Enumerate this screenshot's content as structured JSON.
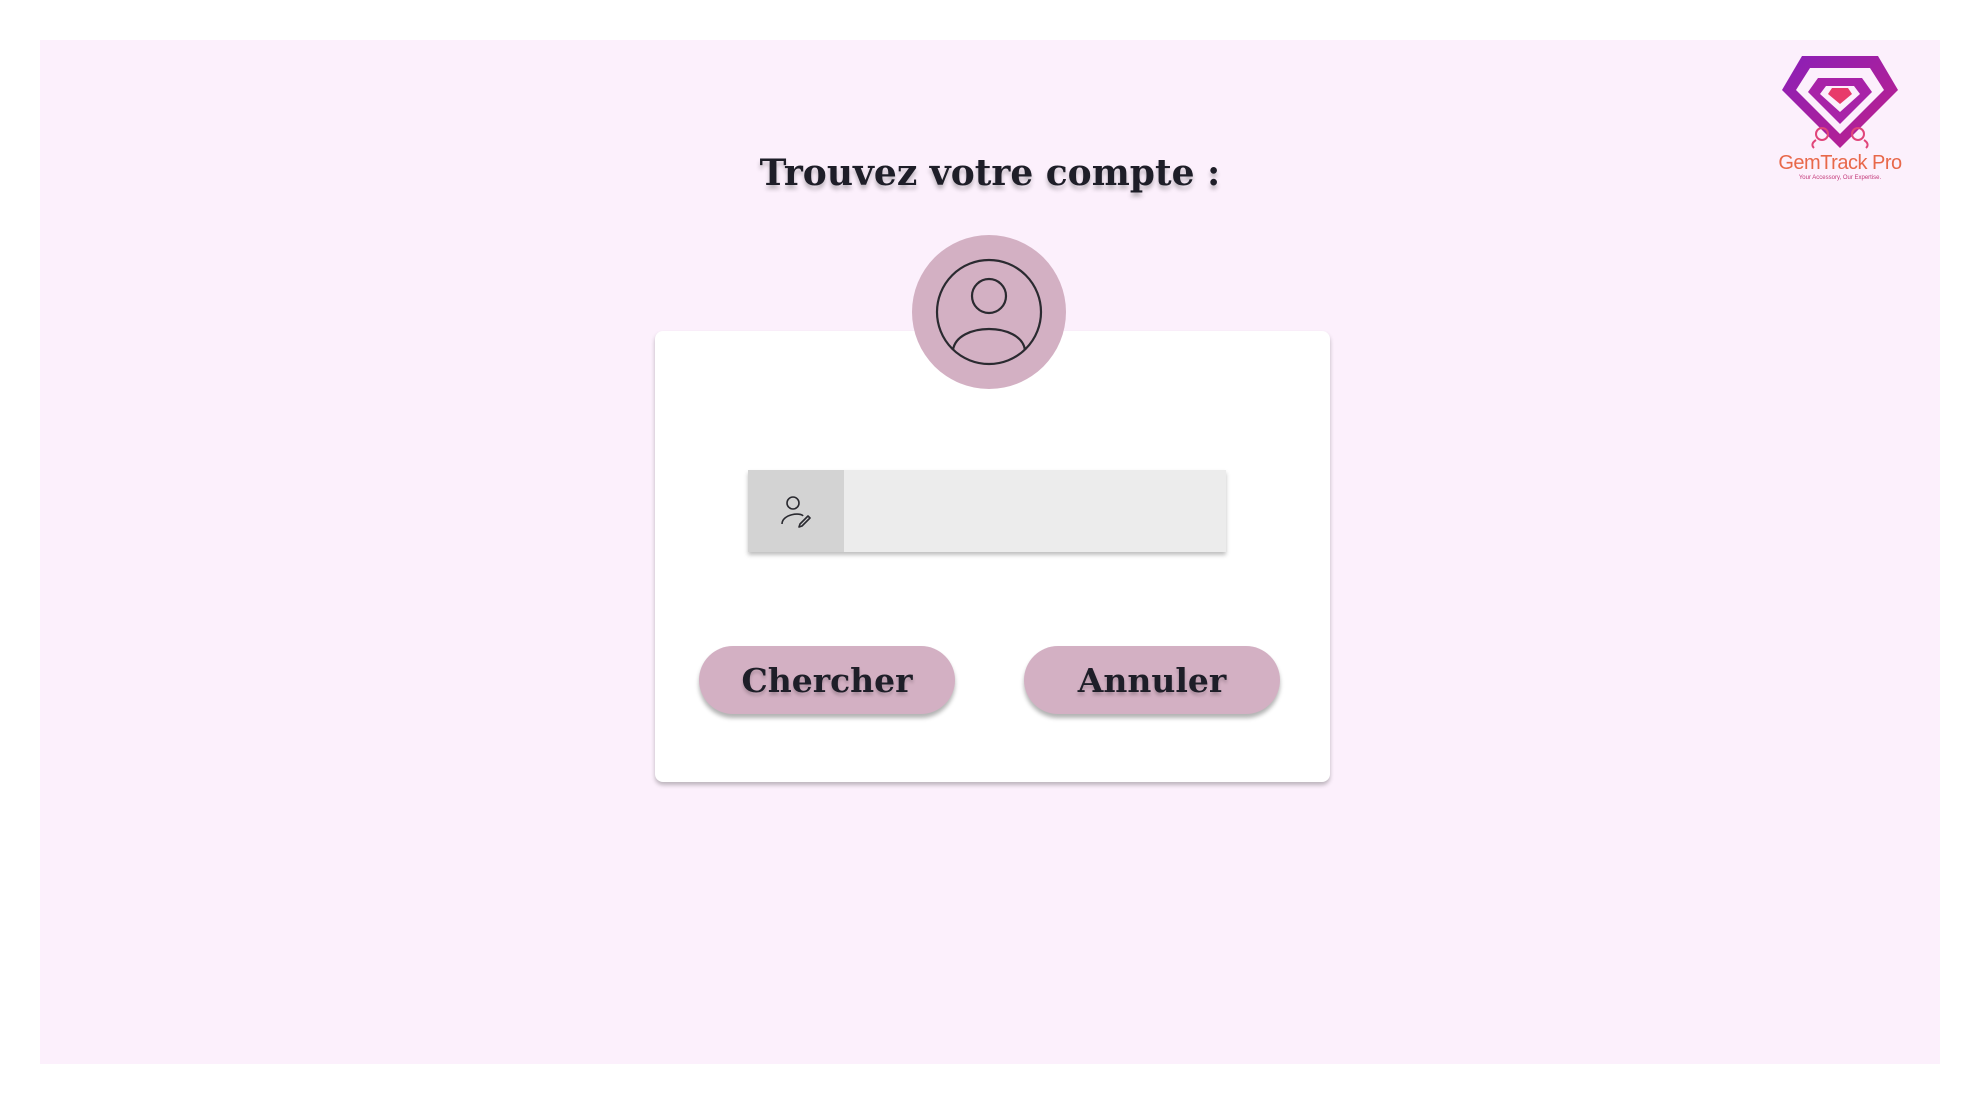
{
  "brand": {
    "name": "GemTrack Pro",
    "tagline": "Your Accessory, Our Expertise.",
    "logo_icon": "diamond-icon",
    "colors": {
      "purple": "#a020b0",
      "coral": "#e8684a",
      "pink": "#e0457a"
    }
  },
  "page": {
    "title": "Trouvez votre compte :",
    "background": "#fcf0fc"
  },
  "avatar": {
    "icon": "user-avatar-icon",
    "color": "#d3b0c3"
  },
  "search": {
    "icon": "user-edit-icon",
    "value": "",
    "placeholder": ""
  },
  "actions": {
    "search_label": "Chercher",
    "cancel_label": "Annuler",
    "button_color": "#d3b0c3"
  }
}
